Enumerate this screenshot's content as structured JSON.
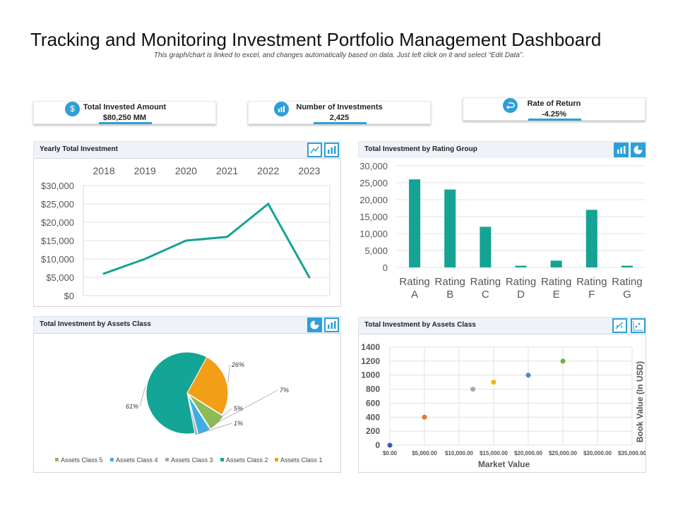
{
  "page": {
    "title": "Tracking and Monitoring Investment Portfolio Management Dashboard",
    "subtitle": "This graph/chart is linked to excel, and changes automatically based on data. Just left click on it and select “Edit Data”."
  },
  "kpis": [
    {
      "label": "Total Invested Amount",
      "value": "$80,250 MM",
      "icon": "dollar-icon"
    },
    {
      "label": "Number of Investments",
      "value": "2,425",
      "icon": "bar-chart-icon"
    },
    {
      "label": "Rate of Return",
      "value": "-4.25%",
      "icon": "return-arrow-icon"
    }
  ],
  "panels": {
    "yearly": {
      "title": "Yearly Total Investment"
    },
    "rating": {
      "title": "Total  Investment  by Rating Group"
    },
    "assets_pie": {
      "title": "Total  Investment by Assets Class"
    },
    "assets_scatter": {
      "title": "Total  Investment by Assets Class"
    }
  },
  "colors": {
    "accent": "#2e9fd6",
    "teal": "#15a393"
  },
  "chart_data": [
    {
      "type": "line",
      "title": "Yearly Total Investment",
      "categories": [
        "2018",
        "2019",
        "2020",
        "2021",
        "2022",
        "2023"
      ],
      "values": [
        6000,
        10000,
        15000,
        16000,
        25000,
        5000
      ],
      "ylim": [
        0,
        30000
      ],
      "yticks": [
        "$0",
        "$5,000",
        "$10,000",
        "$15,000",
        "$20,000",
        "$25,000",
        "$30,000"
      ],
      "ytick_values": [
        0,
        5000,
        10000,
        15000,
        20000,
        25000,
        30000
      ],
      "color": "#15a393",
      "grid": true
    },
    {
      "type": "bar",
      "title": "Total  Investment  by Rating Group",
      "categories": [
        [
          "Rating",
          "A"
        ],
        [
          "Rating",
          "B"
        ],
        [
          "Rating",
          "C"
        ],
        [
          "Rating",
          "D"
        ],
        [
          "Rating",
          "E"
        ],
        [
          "Rating",
          "F"
        ],
        [
          "Rating",
          "G"
        ]
      ],
      "values": [
        26000,
        23000,
        12000,
        500,
        2000,
        17000,
        500
      ],
      "ylim": [
        0,
        30000
      ],
      "yticks": [
        "0",
        "5,000",
        "10,000",
        "15,000",
        "20,000",
        "25,000",
        "30,000"
      ],
      "ytick_values": [
        0,
        5000,
        10000,
        15000,
        20000,
        25000,
        30000
      ],
      "color": "#15a393",
      "grid": true
    },
    {
      "type": "pie",
      "title": "Total  Investment by Assets Class",
      "slices": [
        {
          "name": "Assets Class 1",
          "value": 26,
          "label": "26%",
          "color": "#f29e17"
        },
        {
          "name": "Assets Class 5",
          "value": 7,
          "label": "7%",
          "color": "#8dbb55"
        },
        {
          "name": "Assets Class 4",
          "value": 5,
          "label": "5%",
          "color": "#41aee2"
        },
        {
          "name": "Assets Class 3",
          "value": 1,
          "label": "1%",
          "color": "#a6a6a6"
        },
        {
          "name": "Assets Class 2",
          "value": 61,
          "label": "61%",
          "color": "#13a596"
        }
      ],
      "legend": [
        "Assets Class 5",
        "Assets Class 4",
        "Assets Class 3",
        "Assets Class 2",
        "Assets Class 1"
      ],
      "legend_position": "bottom"
    },
    {
      "type": "scatter",
      "title": "Total  Investment by Assets Class",
      "xlabel": "Market Value",
      "ylabel": "Book Value (In USD)",
      "xlim": [
        0,
        35000
      ],
      "ylim": [
        0,
        1400
      ],
      "xticks": [
        "$0.00",
        "$5,000.00",
        "$10,000.00",
        "$15,000.00",
        "$20,000.00",
        "$25,000.00",
        "$30,000.00",
        "$35,000.00"
      ],
      "xtick_values": [
        0,
        5000,
        10000,
        15000,
        20000,
        25000,
        30000,
        35000
      ],
      "yticks": [
        "0",
        "200",
        "400",
        "600",
        "800",
        "1000",
        "1200",
        "1400"
      ],
      "ytick_values": [
        0,
        200,
        400,
        600,
        800,
        1000,
        1200,
        1400
      ],
      "points": [
        {
          "x": 0,
          "y": 0,
          "color": "#3b5ea8"
        },
        {
          "x": 5000,
          "y": 400,
          "color": "#e8762c"
        },
        {
          "x": 12000,
          "y": 800,
          "color": "#a6a6a6"
        },
        {
          "x": 15000,
          "y": 900,
          "color": "#f2b31b"
        },
        {
          "x": 20000,
          "y": 1000,
          "color": "#4b8bc6"
        },
        {
          "x": 25000,
          "y": 1200,
          "color": "#6dae45"
        }
      ],
      "grid": true
    }
  ]
}
